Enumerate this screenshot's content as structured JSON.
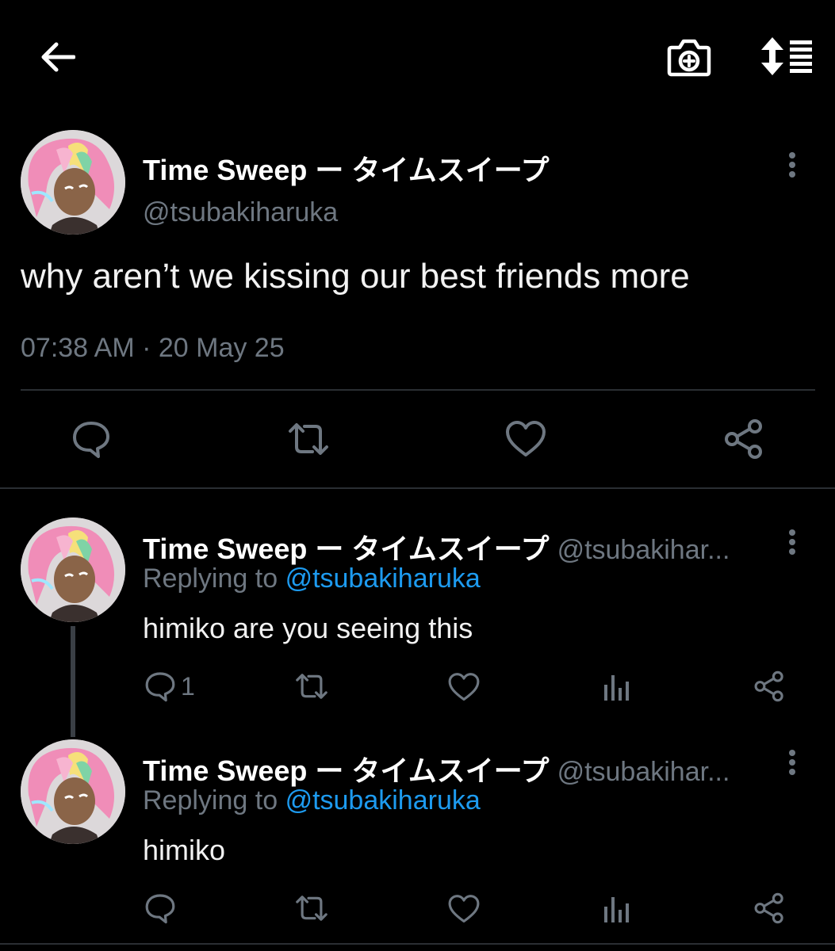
{
  "header": {
    "back_icon": "arrow-left-icon",
    "camera_icon": "camera-plus-icon",
    "sort_icon": "sort-list-icon"
  },
  "main_tweet": {
    "name": "Time Sweep ー タイムスイープ",
    "handle": "@tsubakiharuka",
    "text": "why aren’t we kissing our best friends more",
    "timestamp": "07:38 AM · 20 May 25"
  },
  "replies": [
    {
      "name": "Time Sweep ー タイムスイープ",
      "handle": "@tsubakihar...",
      "replying_prefix": "Replying to",
      "replying_to": "@tsubakiharuka",
      "text": "himiko are you seeing this",
      "reply_count": "1"
    },
    {
      "name": "Time Sweep ー タイムスイープ",
      "handle": "@tsubakihar...",
      "replying_prefix": "Replying to",
      "replying_to": "@tsubakiharuka",
      "text": "himiko",
      "reply_count": ""
    }
  ],
  "colors": {
    "background": "#000000",
    "text": "#e7e9ea",
    "secondary": "#6e7781",
    "link": "#1d9bf0",
    "divider": "#2a2e33"
  }
}
